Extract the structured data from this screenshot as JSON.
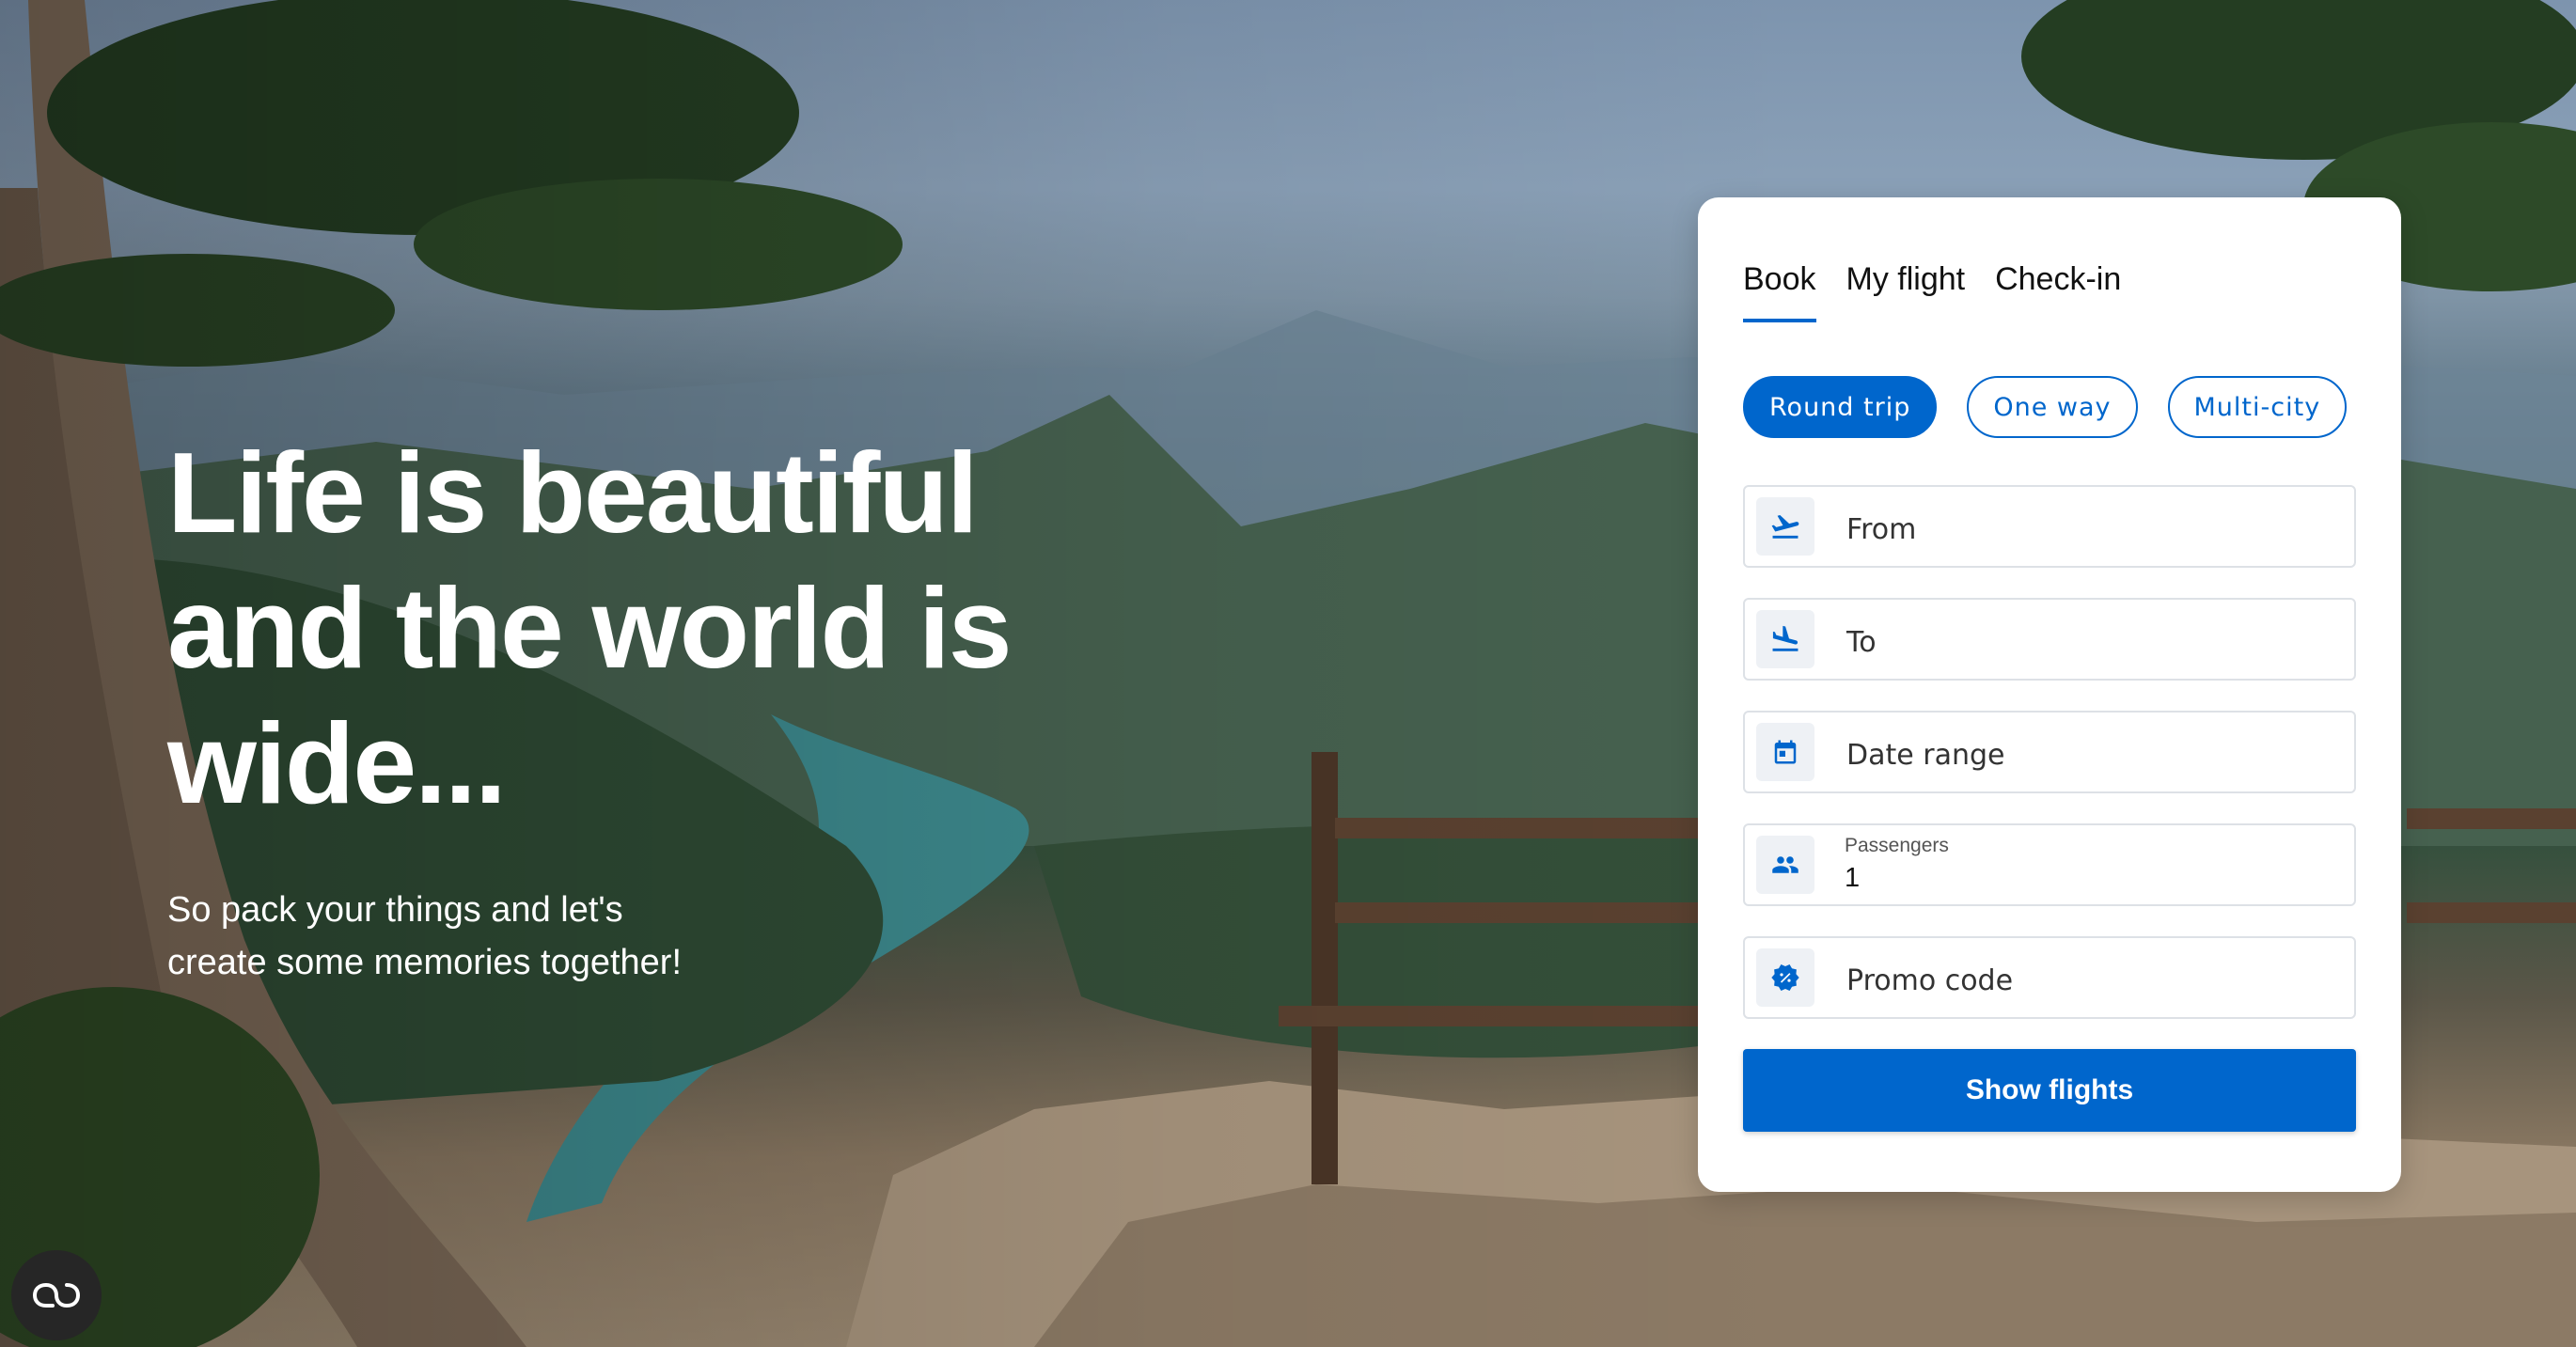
{
  "hero": {
    "title": "Life is beautiful\nand the world is\nwide...",
    "subtitle": "So pack your things and let's\ncreate some memories together!"
  },
  "booking": {
    "tabs": [
      {
        "label": "Book",
        "active": true
      },
      {
        "label": "My flight",
        "active": false
      },
      {
        "label": "Check-in",
        "active": false
      }
    ],
    "trip_types": [
      {
        "label": "Round trip",
        "active": true
      },
      {
        "label": "One way",
        "active": false
      },
      {
        "label": "Multi-city",
        "active": false
      }
    ],
    "fields": {
      "from": {
        "placeholder": "From",
        "icon": "flight-takeoff-icon"
      },
      "to": {
        "placeholder": "To",
        "icon": "flight-land-icon"
      },
      "date_range": {
        "placeholder": "Date range",
        "icon": "calendar-icon"
      },
      "passengers": {
        "label": "Passengers",
        "value": "1",
        "icon": "people-icon"
      },
      "promo_code": {
        "placeholder": "Promo code",
        "icon": "discount-badge-icon"
      }
    },
    "submit_label": "Show flights"
  },
  "accent_color": "#0066cc",
  "floating_button_icon": "infinity-link-icon"
}
